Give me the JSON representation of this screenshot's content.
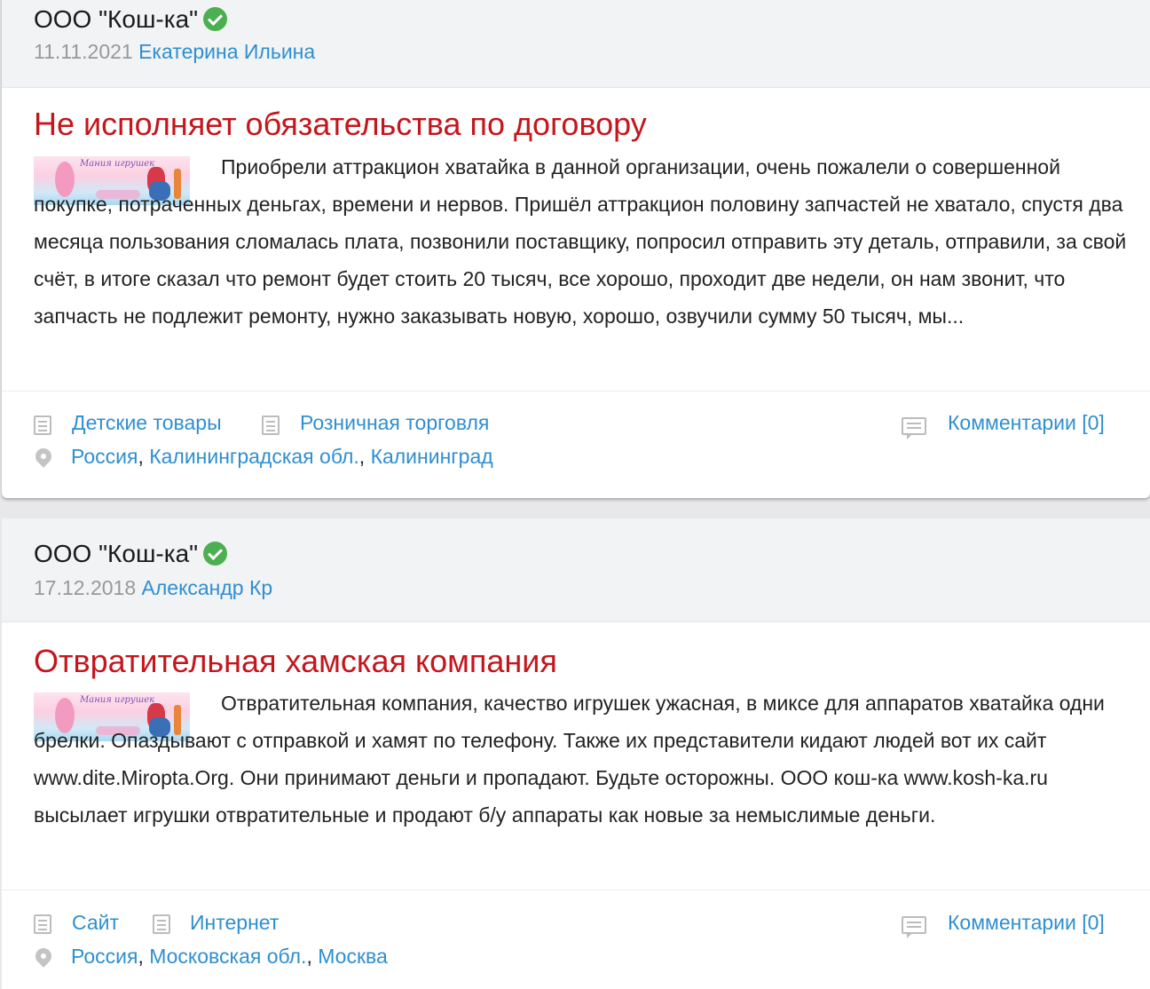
{
  "reviews": [
    {
      "company": "ООО \"Кош-ка\"",
      "date": "11.11.2021",
      "author": "Екатерина Ильина",
      "title": "Не исполняет обязательства по договору",
      "thumb_caption": "Мания игрушек",
      "text": "Приобрели аттракцион хватайка в данной организации, очень пожалели о совершенной покупке, потраченных деньгах, времени и нервов. Пришёл аттракцион половину запчастей не хватало, спустя два месяца пользования сломалась плата, позвонили поставщику, попросил отправить эту деталь, отправили, за свой счёт, в итоге сказал что ремонт будет стоить 20 тысяч, все хорошо, проходит две недели, он нам звонит, что запчасть не подлежит ремонту, нужно заказывать новую, хорошо, озвучили сумму 50 тысяч, мы...",
      "categories": [
        "Детские товары",
        "Розничная торговля"
      ],
      "comments": "Комментарии [0]",
      "location": {
        "country": "Россия",
        "region": "Калининградская обл.",
        "city": "Калининград"
      }
    },
    {
      "company": "ООО \"Кош-ка\"",
      "date": "17.12.2018",
      "author": "Александр Кр",
      "title": "Отвратительная хамская компания",
      "thumb_caption": "Мания игрушек",
      "text": "Отвратительная компания, качество игрушек ужасная, в миксе для аппаратов хватайка одни брелки. Опаздывают с отправкой и хамят по телефону. Также их представители кидают людей вот их сайт www.dite.Miropta.Org. Они принимают деньги и пропадают. Будьте осторожны. ООО кош-ка www.kosh-ka.ru высылает игрушки отвратительные и продают б/у аппараты как новые за немыслимые деньги.",
      "categories": [
        "Сайт",
        "Интернет"
      ],
      "comments": "Комментарии [0]",
      "location": {
        "country": "Россия",
        "region": "Московская обл.",
        "city": "Москва"
      }
    }
  ],
  "separator": ", "
}
